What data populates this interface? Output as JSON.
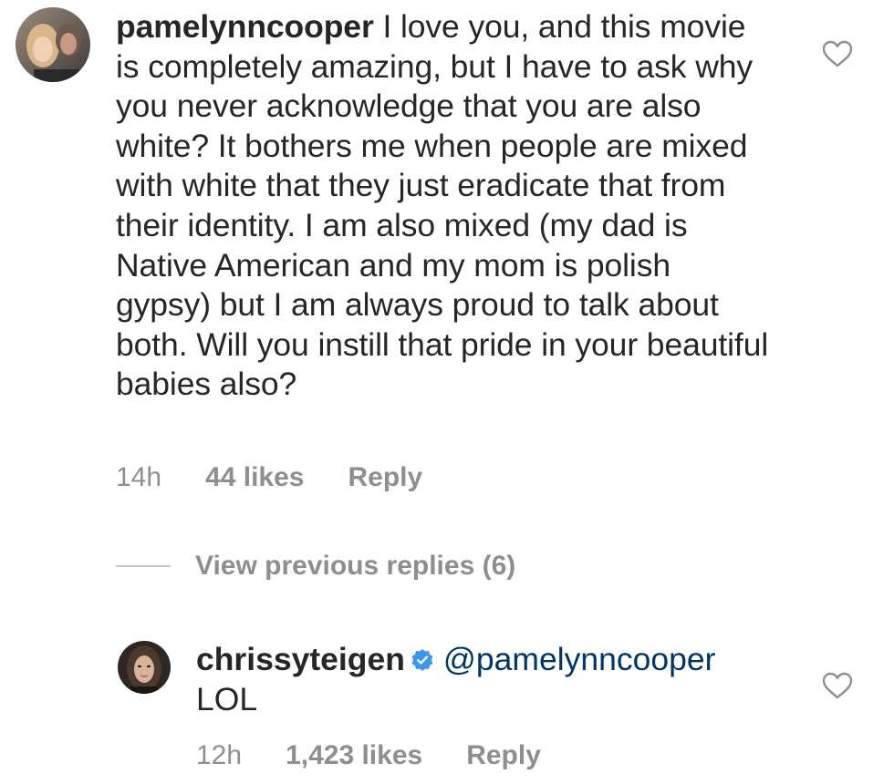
{
  "main_comment": {
    "username": "pamelynncooper",
    "text": "I love you, and this movie is completely amazing, but I have to ask why you never acknowledge that you are also white? It bothers me when people are mixed with white that they just eradicate that from their identity. I am also mixed (my dad is Native American and my mom is polish gypsy) but I am always proud to talk about both. Will you instill that pride in your beautiful babies also?",
    "time": "14h",
    "likes": "44 likes",
    "reply_label": "Reply",
    "avatar_icon": "avatar-photo-icon",
    "like_icon": "heart-outline-icon"
  },
  "view_previous_replies": "View previous replies (6)",
  "reply_comment": {
    "username": "chrissyteigen",
    "verified_icon": "verified-badge-icon",
    "mention": "@pamelynncooper",
    "text": "LOL",
    "time": "12h",
    "likes": "1,423 likes",
    "reply_label": "Reply",
    "avatar_icon": "avatar-photo-icon",
    "like_icon": "heart-outline-icon"
  },
  "colors": {
    "text": "#262626",
    "muted": "#8e8e8e",
    "mention": "#003569",
    "verified": "#3897f0"
  }
}
